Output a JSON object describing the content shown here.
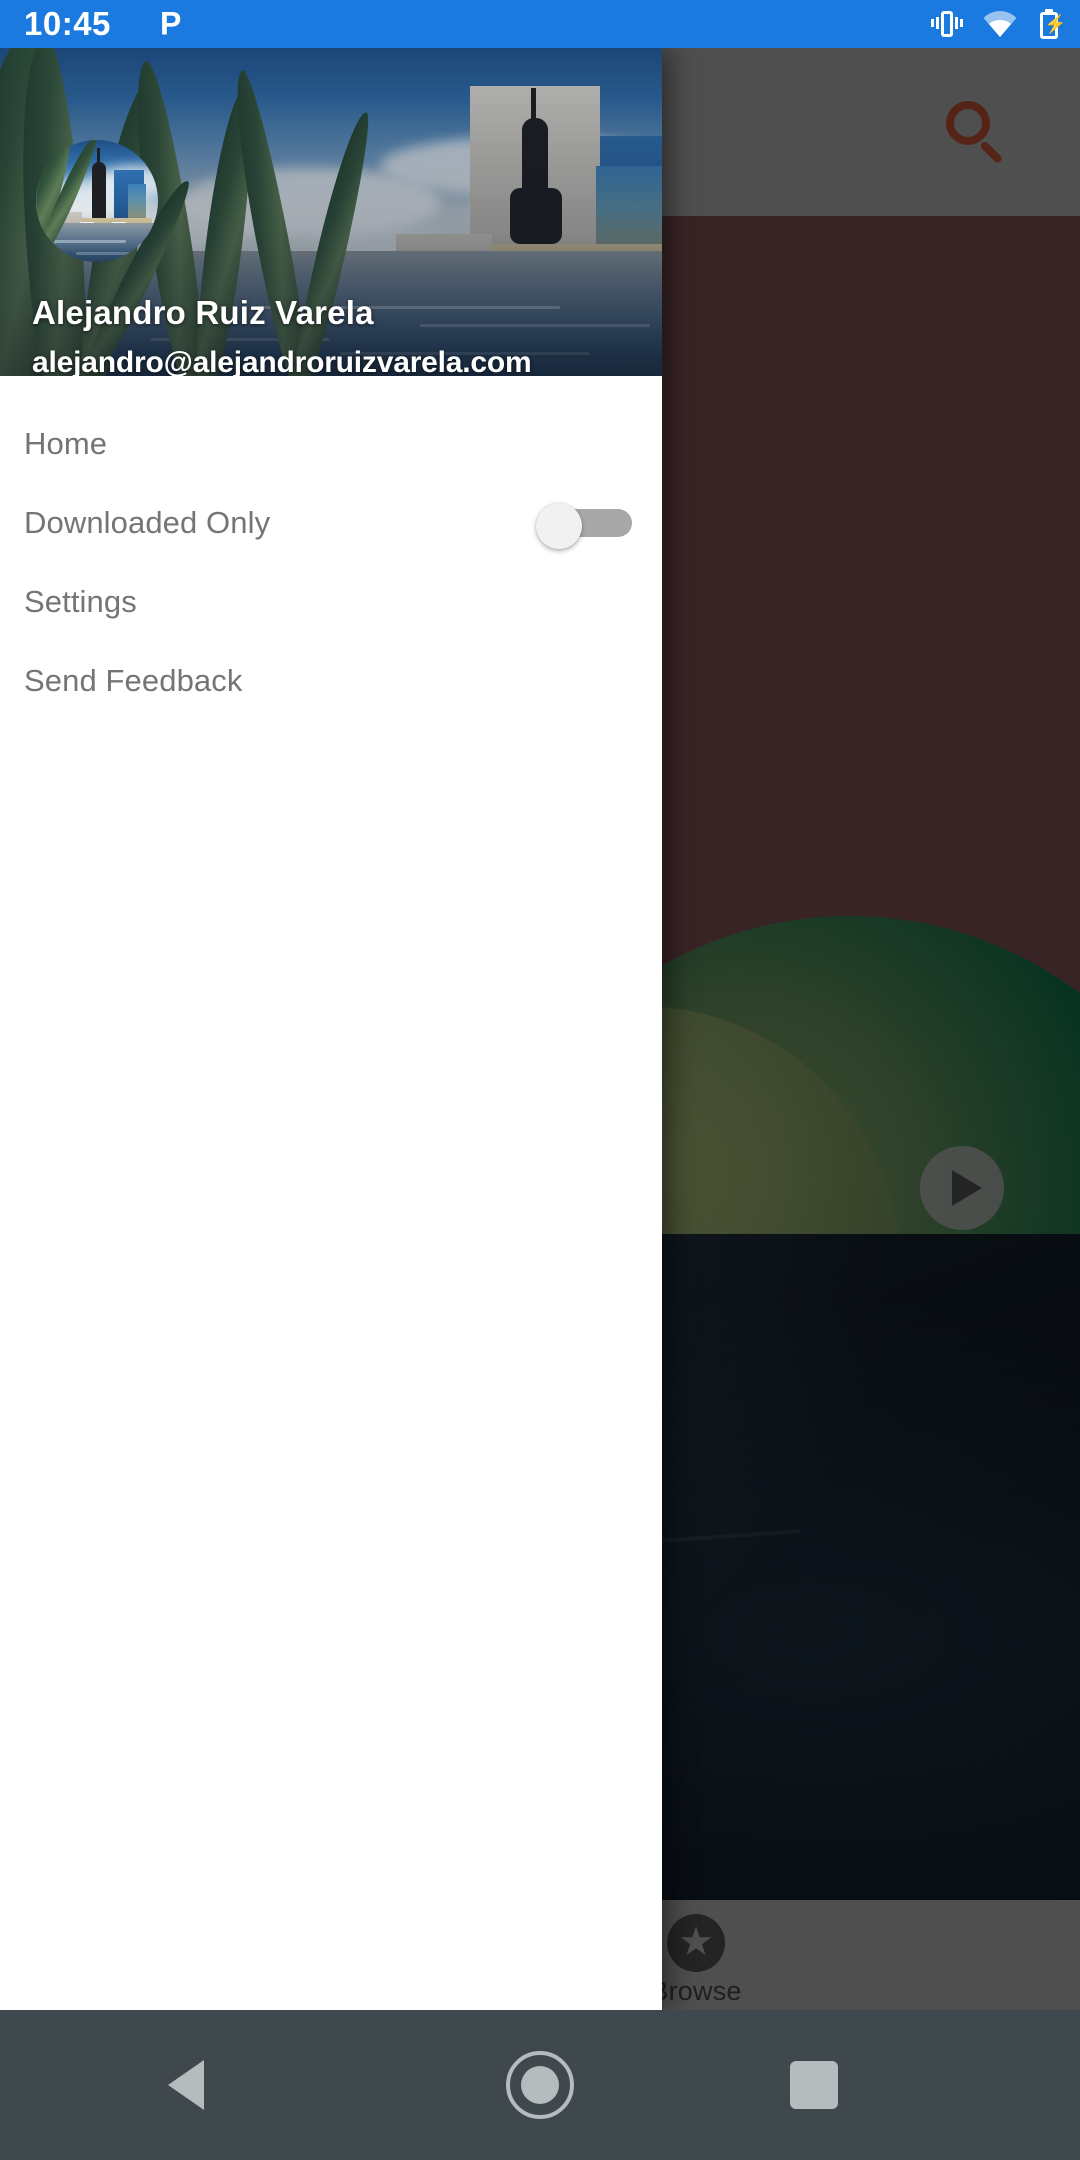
{
  "status_bar": {
    "time": "10:45",
    "app_glyph": "P",
    "icons": [
      "vibrate-icon",
      "wifi-icon",
      "battery-charging-icon"
    ],
    "background_color": "#1b7ae0"
  },
  "drawer": {
    "header": {
      "avatar_alt": "user-avatar",
      "name": "Alejandro Ruiz Varela",
      "email": "alejandro@alejandroruizvarela.com",
      "background_image_alt": "monument-fountain-photo"
    },
    "items": [
      {
        "label": "Home",
        "type": "link"
      },
      {
        "label": "Downloaded Only",
        "type": "switch",
        "switch_state": "off"
      },
      {
        "label": "Settings",
        "type": "link"
      },
      {
        "label": "Send Feedback",
        "type": "link"
      }
    ],
    "background_color": "#ffffff",
    "label_color": "#757575"
  },
  "background_app": {
    "appbar": {
      "search_icon": "search-icon",
      "search_icon_color": "#8c3a25",
      "background_color": "#808080"
    },
    "hero": {
      "play_button": "play-icon",
      "background_color": "#5c3a3c"
    },
    "bottom_nav": {
      "tabs": [
        {
          "label": "Browse",
          "icon": "star-icon"
        }
      ],
      "background_color": "#808080"
    },
    "scrim_color": "rgba(0,0,0,0.38)"
  },
  "system_nav": {
    "buttons": [
      {
        "label": "Back",
        "icon": "back-triangle-icon"
      },
      {
        "label": "Home",
        "icon": "home-circle-icon"
      },
      {
        "label": "Recents",
        "icon": "recents-square-icon"
      }
    ],
    "background_color": "#3f484c",
    "icon_color": "#b5bcbe"
  }
}
